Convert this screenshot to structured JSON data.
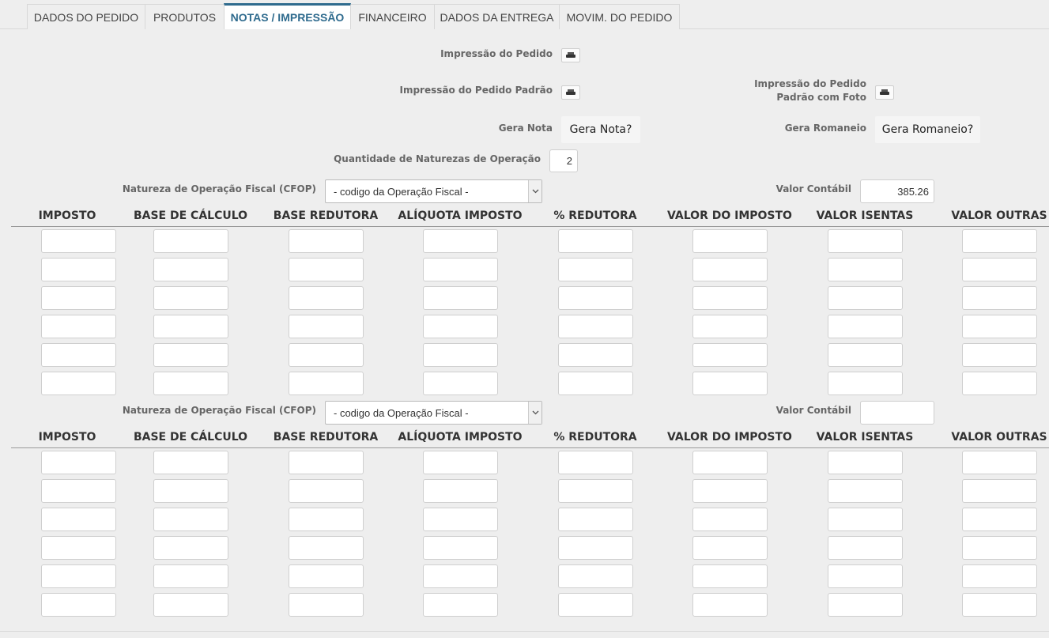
{
  "tabs": [
    {
      "label": "DADOS DO PEDIDO",
      "active": false
    },
    {
      "label": "PRODUTOS",
      "active": false
    },
    {
      "label": "NOTAS / IMPRESSÃO",
      "active": true
    },
    {
      "label": "FINANCEIRO",
      "active": false
    },
    {
      "label": "DADOS DA ENTREGA",
      "active": false
    },
    {
      "label": "MOVIM. DO PEDIDO",
      "active": false
    }
  ],
  "print": {
    "pedido_label": "Impressão do Pedido",
    "pedido_padrao_label": "Impressão do Pedido Padrão",
    "pedido_padrao_foto_label_line1": "Impressão do Pedido",
    "pedido_padrao_foto_label_line2": "Padrão com Foto",
    "icon": "printer-icon"
  },
  "gera": {
    "nota_label": "Gera Nota",
    "nota_button": "Gera Nota?",
    "romaneio_label": "Gera Romaneio",
    "romaneio_button": "Gera Romaneio?"
  },
  "quantidade": {
    "label": "Quantidade de Naturezas de Operação",
    "value": "2"
  },
  "blocks": [
    {
      "cfop_label": "Natureza de Operação Fiscal (CFOP)",
      "cfop_selected": "- codigo da Operação Fiscal -",
      "valor_contabil_label": "Valor Contábil",
      "valor_contabil_value": "385.26"
    },
    {
      "cfop_label": "Natureza de Operação Fiscal (CFOP)",
      "cfop_selected": "- codigo da Operação Fiscal -",
      "valor_contabil_label": "Valor Contábil",
      "valor_contabil_value": ""
    }
  ],
  "columns": [
    "IMPOSTO",
    "BASE DE CÁLCULO",
    "BASE REDUTORA",
    "ALÍQUOTA IMPOSTO",
    "% REDUTORA",
    "VALOR DO IMPOSTO",
    "VALOR ISENTAS",
    "VALOR OUTRAS"
  ],
  "colors": {
    "accent": "#2f6b8e",
    "background": "#eeeeee"
  }
}
